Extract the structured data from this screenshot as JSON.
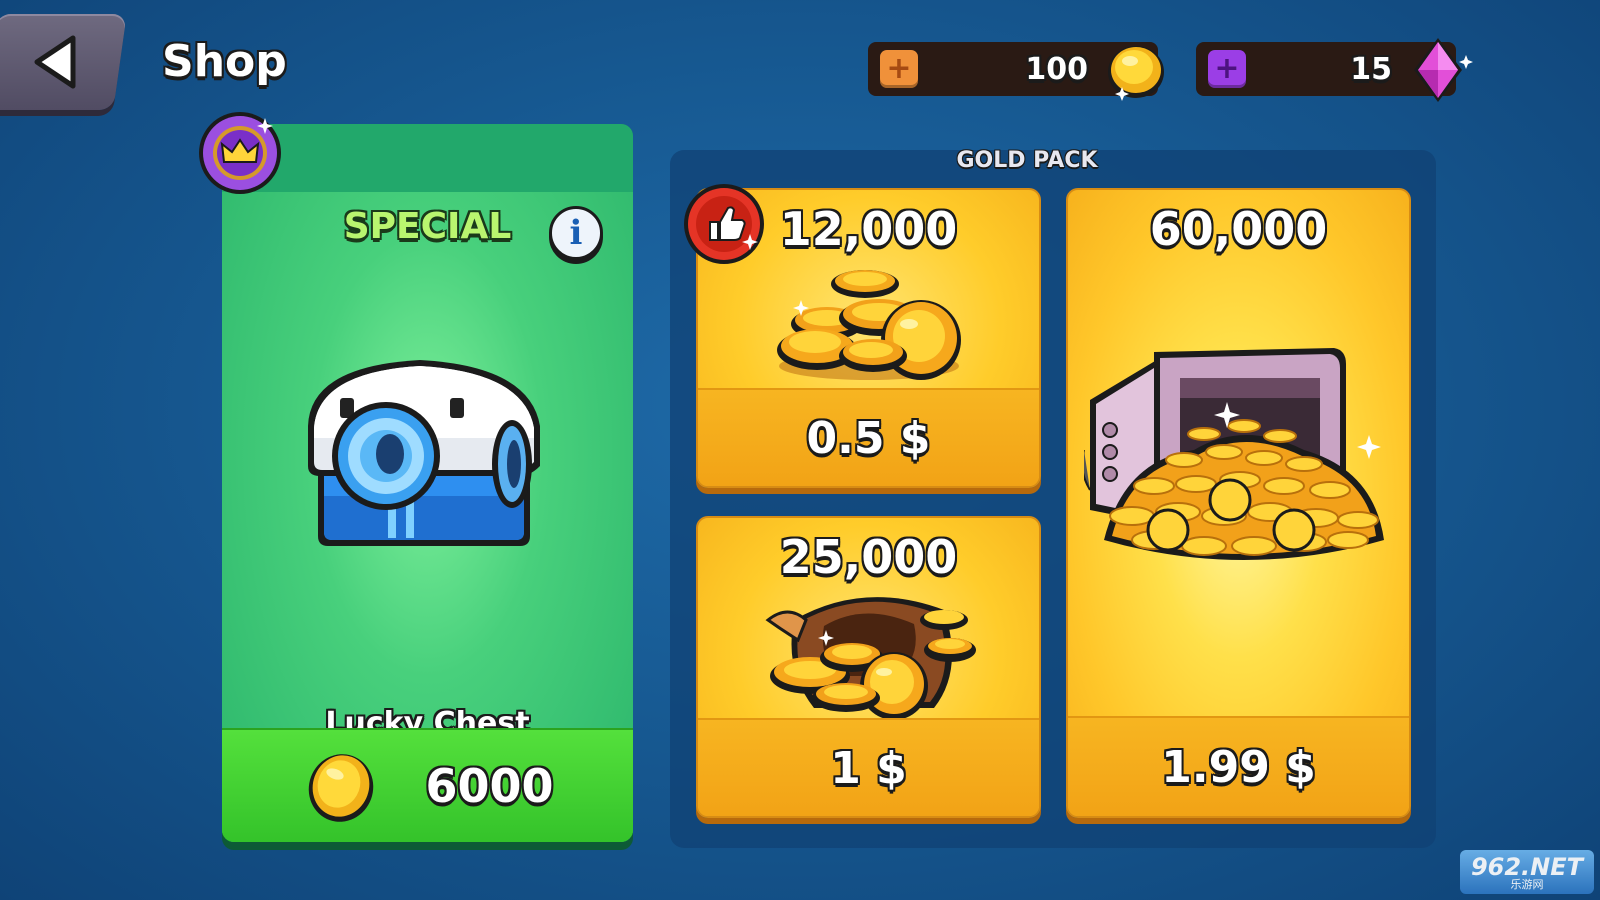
{
  "header": {
    "title": "Shop",
    "back_icon": "back-arrow-icon"
  },
  "currencies": {
    "gold": {
      "amount": "100",
      "icon": "gold-coin-icon",
      "add_icon": "plus-icon",
      "color": "#f0913a"
    },
    "gems": {
      "amount": "15",
      "icon": "gem-icon",
      "add_icon": "plus-icon",
      "color": "#9b3ee6"
    }
  },
  "special": {
    "label": "SPECIAL",
    "info_label": "i",
    "item_name": "Lucky Chest",
    "price": "6000",
    "price_icon": "gold-coin-icon",
    "badge_icon": "crown-icon",
    "color": "#2bb56b"
  },
  "gold_pack": {
    "title": "GOLD PACK",
    "packs": [
      {
        "amount": "12,000",
        "price": "0.5 $",
        "badge_icon": "thumbs-up-icon"
      },
      {
        "amount": "25,000",
        "price": "1 $"
      },
      {
        "amount": "60,000",
        "price": "1.99 $"
      }
    ]
  },
  "watermark": {
    "top": "962.NET",
    "bottom": "乐游网"
  }
}
